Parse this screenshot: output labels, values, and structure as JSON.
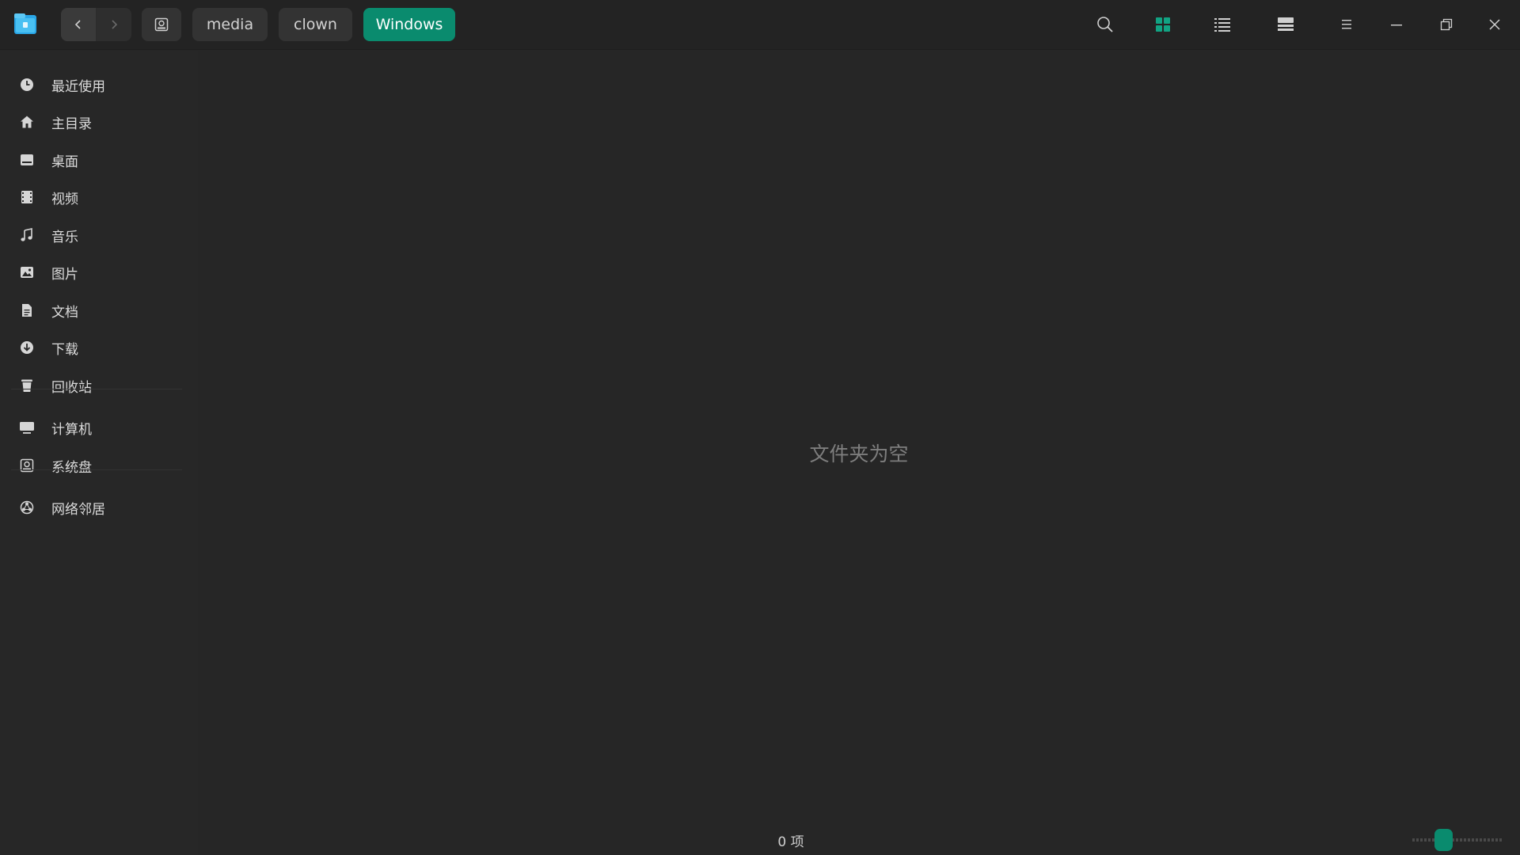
{
  "toolbar": {
    "breadcrumbs": [
      "media",
      "clown",
      "Windows"
    ],
    "icons": {
      "back": "chevron-left-icon",
      "forward": "chevron-right-icon",
      "disk": "disk-icon",
      "search": "search-icon",
      "icon_view": "grid-view-icon",
      "list_view": "list-view-icon",
      "detail_view": "detail-panel-icon",
      "menu": "hamburger-menu-icon",
      "minimize": "minimize-icon",
      "restore": "restore-icon",
      "close": "close-icon"
    },
    "accent_color": "#0a8b6e"
  },
  "sidebar": {
    "items": [
      {
        "label": "最近使用",
        "icon": "clock-icon"
      },
      {
        "label": "主目录",
        "icon": "home-icon"
      },
      {
        "label": "桌面",
        "icon": "desktop-icon"
      },
      {
        "label": "视频",
        "icon": "video-icon"
      },
      {
        "label": "音乐",
        "icon": "music-icon"
      },
      {
        "label": "图片",
        "icon": "picture-icon"
      },
      {
        "label": "文档",
        "icon": "document-icon"
      },
      {
        "label": "下载",
        "icon": "download-icon"
      },
      {
        "label": "回收站",
        "icon": "trash-icon"
      },
      {
        "label": "计算机",
        "icon": "computer-icon"
      },
      {
        "label": "系统盘",
        "icon": "disk-icon"
      },
      {
        "label": "网络邻居",
        "icon": "network-icon"
      }
    ]
  },
  "content": {
    "empty_message": "文件夹为空"
  },
  "statusbar": {
    "item_count": "0 项",
    "zoom_level": 0.3
  }
}
